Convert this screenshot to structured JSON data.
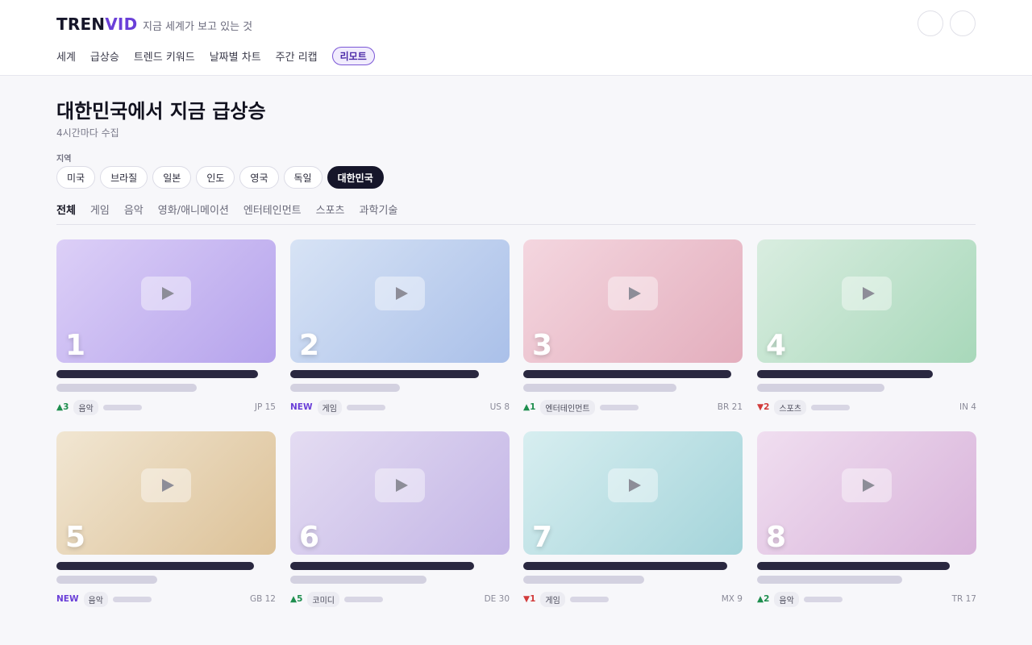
{
  "brand": {
    "name_part1": "TREN",
    "name_part2": "VID",
    "tagline": "지금 세계가 보고 있는 것"
  },
  "nav": {
    "items": [
      "세계",
      "급상승",
      "트렌드 키워드",
      "날짜별 차트",
      "주간 리캡"
    ],
    "highlight": "리모트"
  },
  "page": {
    "title": "대한민국에서 지금 급상승",
    "subtitle": "4시간마다 수집",
    "region_label": "지역"
  },
  "regions": [
    {
      "label": "미국",
      "active": false
    },
    {
      "label": "브라질",
      "active": false
    },
    {
      "label": "일본",
      "active": false
    },
    {
      "label": "인도",
      "active": false
    },
    {
      "label": "영국",
      "active": false
    },
    {
      "label": "독일",
      "active": false
    },
    {
      "label": "대한민국",
      "active": true
    }
  ],
  "categories": [
    {
      "label": "전체",
      "active": true
    },
    {
      "label": "게임",
      "active": false
    },
    {
      "label": "음악",
      "active": false
    },
    {
      "label": "영화/애니메이션",
      "active": false
    },
    {
      "label": "엔터테인먼트",
      "active": false
    },
    {
      "label": "스포츠",
      "active": false
    },
    {
      "label": "과학기술",
      "active": false
    }
  ],
  "videos": [
    {
      "rank": "1",
      "delta": "▲3",
      "delta_type": "up",
      "tag": "음악",
      "code": "JP 15",
      "title_fill": 0.92,
      "sub_fill": 0.64,
      "colors": [
        "#dccff7",
        "#b5a3ec"
      ]
    },
    {
      "rank": "2",
      "delta": "NEW",
      "delta_type": "new",
      "tag": "게임",
      "code": "US 8",
      "title_fill": 0.86,
      "sub_fill": 0.5,
      "colors": [
        "#d7e3f5",
        "#aac0e9"
      ]
    },
    {
      "rank": "3",
      "delta": "▲1",
      "delta_type": "up",
      "tag": "엔터테인먼트",
      "code": "BR 21",
      "title_fill": 0.95,
      "sub_fill": 0.7,
      "colors": [
        "#f4d6df",
        "#e3aebd"
      ]
    },
    {
      "rank": "4",
      "delta": "▼2",
      "delta_type": "down",
      "tag": "스포츠",
      "code": "IN 4",
      "title_fill": 0.8,
      "sub_fill": 0.58,
      "colors": [
        "#d9ede0",
        "#a8d8ba"
      ]
    },
    {
      "rank": "5",
      "delta": "NEW",
      "delta_type": "new",
      "tag": "음악",
      "code": "GB 12",
      "title_fill": 0.9,
      "sub_fill": 0.46,
      "colors": [
        "#f1e6d2",
        "#dcc197"
      ]
    },
    {
      "rank": "6",
      "delta": "▲5",
      "delta_type": "up",
      "tag": "코미디",
      "code": "DE 30",
      "title_fill": 0.84,
      "sub_fill": 0.62,
      "colors": [
        "#e4dcf2",
        "#c3b5e6"
      ]
    },
    {
      "rank": "7",
      "delta": "▼1",
      "delta_type": "down",
      "tag": "게임",
      "code": "MX 9",
      "title_fill": 0.93,
      "sub_fill": 0.55,
      "colors": [
        "#d7eef0",
        "#a4d4da"
      ]
    },
    {
      "rank": "8",
      "delta": "▲2",
      "delta_type": "up",
      "tag": "음악",
      "code": "TR 17",
      "title_fill": 0.88,
      "sub_fill": 0.66,
      "colors": [
        "#f0def0",
        "#d8b3da"
      ]
    }
  ]
}
